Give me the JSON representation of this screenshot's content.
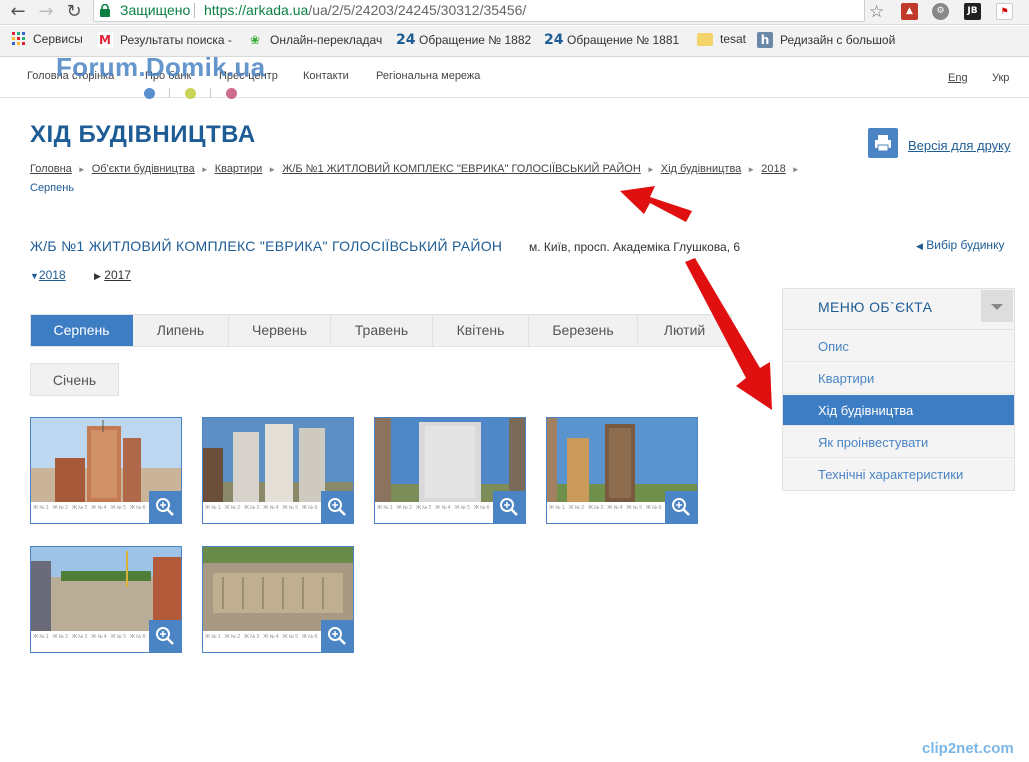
{
  "browser": {
    "secure_label": "Защищено",
    "url_scheme": "https://",
    "url_host": "arkada.ua",
    "url_path": "/ua/2/5/24203/24245/30312/35456/"
  },
  "bookmarks": [
    {
      "label": "Сервисы",
      "icon": "apps-grid-icon"
    },
    {
      "label": "Результаты поиска -",
      "icon": "gmail-icon"
    },
    {
      "label": "Онлайн-переклaдач",
      "icon": "puzzle-icon"
    },
    {
      "label": "Обращение № 1882",
      "icon": "24-icon",
      "glyph": "24"
    },
    {
      "label": "Обращение № 1881",
      "icon": "24-icon",
      "glyph": "24"
    },
    {
      "label": "tesat",
      "icon": "folder-icon"
    },
    {
      "label": "Редизайн с большой",
      "icon": "h-icon",
      "glyph": "h"
    }
  ],
  "topnav": {
    "items": [
      "Головна сторінка",
      "Про банк",
      "Прес-центр",
      "Контакти",
      "Регіональна мережа"
    ],
    "lang_en": "Eng",
    "lang_ua": "Укр",
    "watermark": "Forum.Domik.ua"
  },
  "page": {
    "title": "ХІД БУДІВНИЦТВА",
    "print_label": "Версія для друку",
    "breadcrumbs": [
      "Головна",
      "Об'єкти будівництва",
      "Квартири",
      "Ж/Б №1 ЖИТЛОВИЙ КОМПЛЕКС \"ЕВРИКА\" ГОЛОСІЇВСЬКИЙ РАЙОН",
      "Хід будівництва",
      "2018"
    ],
    "breadcrumb_current": "Серпень",
    "object_title": "Ж/Б №1 ЖИТЛОВИЙ КОМПЛЕКС \"ЕВРИКА\" ГОЛОСІЇВСЬКИЙ РАЙОН",
    "object_address": "м. Київ, просп. Академіка Глушкова, 6",
    "pick_building": "Вибір будинку",
    "years": [
      "2018",
      "2017"
    ],
    "months": [
      "Серпень",
      "Липень",
      "Червень",
      "Травень",
      "Квітень",
      "Березень",
      "Лютий"
    ],
    "months_row2": [
      "Січень"
    ],
    "active_month": "Серпень",
    "thumb_strip": "Ж№1   Ж№2   Ж№3   Ж№4   Ж№5   Ж№6   Ж№7   Ж№8   Ж№9"
  },
  "side_menu": {
    "title": "МЕНЮ ОБ`ЄКТА",
    "items": [
      "Опис",
      "Квартири",
      "Хід будівництва",
      "Як проінвестувати",
      "Технічні характеристики"
    ],
    "active": "Хід будівництва"
  },
  "footer_logo": "clip2net.com",
  "colors": {
    "brand_blue": "#1d5c94",
    "active_blue": "#3d7dc4",
    "annotation_red": "#e01010"
  }
}
